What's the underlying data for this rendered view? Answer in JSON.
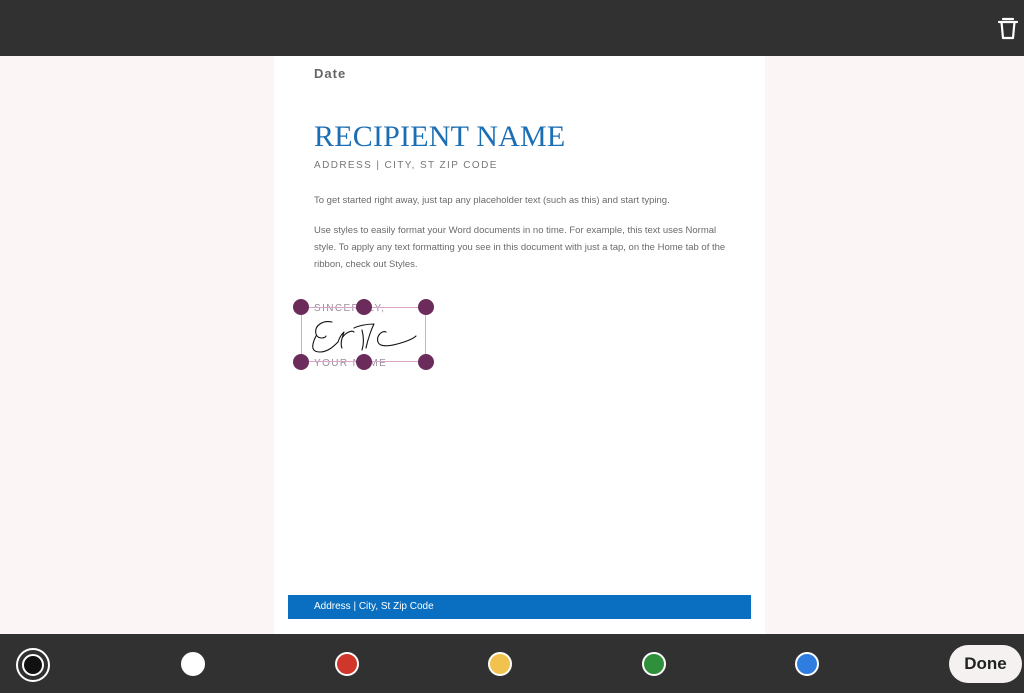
{
  "toolbar": {
    "trash_icon": "trash-icon"
  },
  "document": {
    "date": "Date",
    "recipient_name": "RECIPIENT NAME",
    "address_line": "ADDRESS | CITY, ST ZIP CODE",
    "paragraphs": [
      "To get started right away, just tap any placeholder text (such as this) and start typing.",
      "Use styles to easily format your Word documents in no time. For example, this text uses Normal style. To apply any text formatting you see in this document with just a tap, on the Home tab of the ribbon, check out Styles."
    ],
    "closing": "SINCERELY,",
    "signer": "YOUR NAME",
    "footer": "Address | City, St Zip Code"
  },
  "signature": {
    "ink_color": "#111111"
  },
  "palette": {
    "selected": "black",
    "colors": [
      {
        "name": "black",
        "hex": "#111111"
      },
      {
        "name": "white",
        "hex": "#ffffff"
      },
      {
        "name": "red",
        "hex": "#d0362a"
      },
      {
        "name": "yellow",
        "hex": "#f2c24f"
      },
      {
        "name": "green",
        "hex": "#2f8f3b"
      },
      {
        "name": "blue",
        "hex": "#2f7de1"
      }
    ]
  },
  "done_label": "Done",
  "colors": {
    "bar_bg": "#313131",
    "handle": "#6b2c5c",
    "accent_blue": "#1c6eb4",
    "footer_blue": "#0a6fc0"
  }
}
